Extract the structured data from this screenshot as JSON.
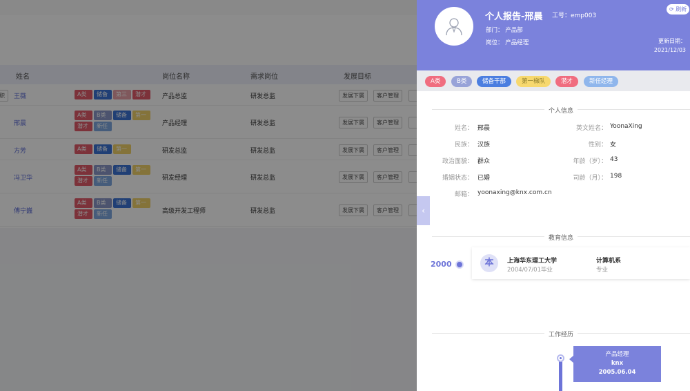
{
  "background": {
    "table": {
      "headers": [
        "姓名",
        "岗位名称",
        "需求岗位",
        "发展目标"
      ],
      "left_clip_text": "职",
      "rows": [
        {
          "name": "王薇",
          "tags": [
            [
              "A类",
              "#e25b6a"
            ],
            [
              "储备",
              "#3b74d6"
            ],
            [
              "第三",
              "#e8a0a8"
            ],
            [
              "潜才",
              "#e25b6a"
            ]
          ],
          "position": "产品总监",
          "need": "研发总监",
          "actions": [
            "发展下属",
            "客户管理"
          ]
        },
        {
          "name": "邢晨",
          "tags": [
            [
              "A类",
              "#e25b6a"
            ],
            [
              "B类",
              "#8a98c8"
            ],
            [
              "储备",
              "#3b74d6"
            ],
            [
              "第一",
              "#f0d26a"
            ],
            [
              "潜才",
              "#e25b6a"
            ],
            [
              "新任",
              "#7fa8e0"
            ]
          ],
          "position": "产品经理",
          "need": "研发总监",
          "actions": [
            "发展下属",
            "客户管理"
          ]
        },
        {
          "name": "方芳",
          "tags": [
            [
              "A类",
              "#e25b6a"
            ],
            [
              "储备",
              "#3b74d6"
            ],
            [
              "第一",
              "#f0d26a"
            ]
          ],
          "position": "研发总监",
          "need": "研发总监",
          "actions": [
            "发展下属",
            "客户管理"
          ]
        },
        {
          "name": "冯卫华",
          "tags": [
            [
              "A类",
              "#e25b6a"
            ],
            [
              "B类",
              "#8a98c8"
            ],
            [
              "储备",
              "#3b74d6"
            ],
            [
              "第一",
              "#f0d26a"
            ],
            [
              "潜才",
              "#e25b6a"
            ],
            [
              "新任",
              "#7fa8e0"
            ]
          ],
          "position": "研发经理",
          "need": "研发总监",
          "actions": [
            "发展下属",
            "客户管理"
          ]
        },
        {
          "name": "傅宁巍",
          "tags": [
            [
              "A类",
              "#e25b6a"
            ],
            [
              "B类",
              "#8a98c8"
            ],
            [
              "储备",
              "#3b74d6"
            ],
            [
              "第一",
              "#f0d26a"
            ],
            [
              "潜才",
              "#e25b6a"
            ],
            [
              "新任",
              "#7fa8e0"
            ]
          ],
          "position": "高级开发工程师",
          "need": "研发总监",
          "actions": [
            "发展下属",
            "客户管理"
          ]
        }
      ]
    }
  },
  "drawer": {
    "title": "个人报告-邢晨",
    "employee_id": "工号：emp003",
    "department": "部门：  产品部",
    "position": "岗位：  产品经理",
    "refresh_label": "刷新",
    "updated_label": "更新日期：",
    "updated_date": "2021/12/03",
    "tags": [
      {
        "label": "A类",
        "color": "#f06d7f"
      },
      {
        "label": "B类",
        "color": "#98a3d8"
      },
      {
        "label": "储备干部",
        "color": "#4b7ee0"
      },
      {
        "label": "第一梯队",
        "color": "#f7d86e"
      },
      {
        "label": "潜才",
        "color": "#f06d7f"
      },
      {
        "label": "新任经理",
        "color": "#8fb6ec"
      }
    ],
    "personal_section": "个人信息",
    "personal": {
      "name_label": "姓名：",
      "name": "邢晨",
      "en_name_label": "英文姓名：",
      "en_name": "YoonaXing",
      "ethnic_label": "民族：",
      "ethnic": "汉族",
      "gender_label": "性别：",
      "gender": "女",
      "political_label": "政治面貌：",
      "political": "群众",
      "age_label": "年龄（岁）：",
      "age": "43",
      "marital_label": "婚姻状态：",
      "marital": "已婚",
      "tenure_label": "司龄（月）：",
      "tenure": "198",
      "email_label": "邮箱：",
      "email": "yoonaxing@knx.com.cn"
    },
    "education_section": "教育信息",
    "education": {
      "year": "2000",
      "badge": "本",
      "school": "上海华东理工大学",
      "grad_date": "2004/07/01毕业",
      "major": "计算机系",
      "major_label": "专业"
    },
    "work_section": "工作经历",
    "work": {
      "title": "产品经理",
      "company": "knx",
      "date": "2005.06.04"
    },
    "collapse_glyph": "‹"
  },
  "colors": {
    "header_bg": "#7b82dc",
    "accent": "#6d74d8"
  }
}
